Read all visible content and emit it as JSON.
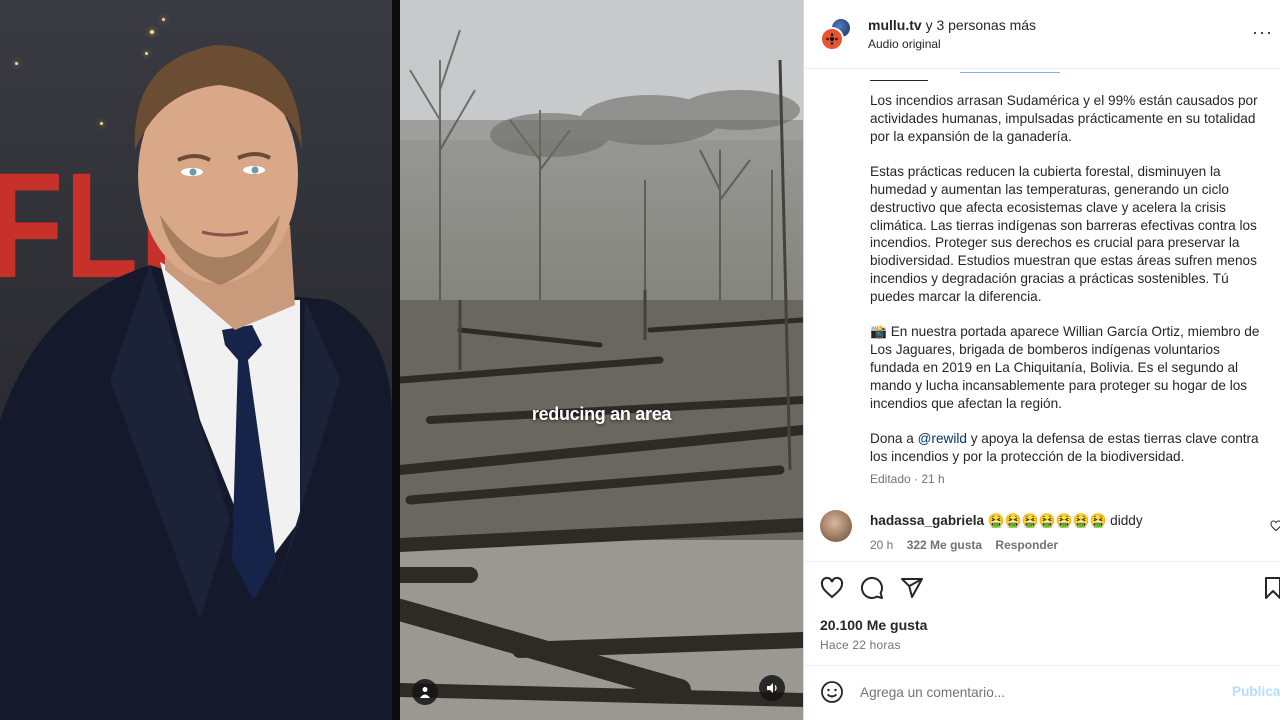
{
  "post": {
    "author": "mullu.tv",
    "collab_text": "y 3 personas más",
    "audio": "Audio original",
    "more": "···"
  },
  "video": {
    "caption": "reducing an area"
  },
  "caption": {
    "paragraphs": [
      "Los incendios arrasan Sudamérica y el 99% están causados por actividades humanas, impulsadas prácticamente en su totalidad por la expansión de la ganadería.",
      "Estas prácticas reducen la cubierta forestal, disminuyen la humedad y aumentan las temperaturas, generando un ciclo destructivo que afecta ecosistemas clave y acelera la crisis climática. Las tierras indígenas son barreras efectivas contra los incendios. Proteger sus derechos es crucial para preservar la biodiversidad. Estudios muestran que estas áreas sufren menos incendios y degradación gracias a prácticas sostenibles. Tú puedes marcar la diferencia.",
      "📸 En nuestra portada aparece Willian García Ortiz, miembro de Los Jaguares, brigada de bomberos indígenas voluntarios fundada en 2019 en La Chiquitanía, Bolivia. Es el segundo al mando y lucha incansablemente para proteger su hogar de los incendios que afectan la región."
    ],
    "last_before": "Dona a ",
    "last_mention": "@rewild",
    "last_after": " y apoya la defensa de estas tierras clave contra los incendios y por la protección de la biodiversidad.",
    "edited": "Editado · 21 h"
  },
  "comment": {
    "username": "hadassa_gabriela",
    "text": "🤮🤮🤮🤮🤮🤮🤮 diddy",
    "time": "20 h",
    "likes": "322 Me gusta",
    "reply": "Responder"
  },
  "stats": {
    "likes": "20.100 Me gusta",
    "ago": "Hace 22 horas"
  },
  "add_comment": {
    "placeholder": "Agrega un comentario...",
    "post_label": "Publicar"
  },
  "colors": {
    "brand_red": "#c8302a",
    "link": "#00376b",
    "post_disabled": "#b2dffc",
    "avatar_orange": "#e8542f"
  }
}
